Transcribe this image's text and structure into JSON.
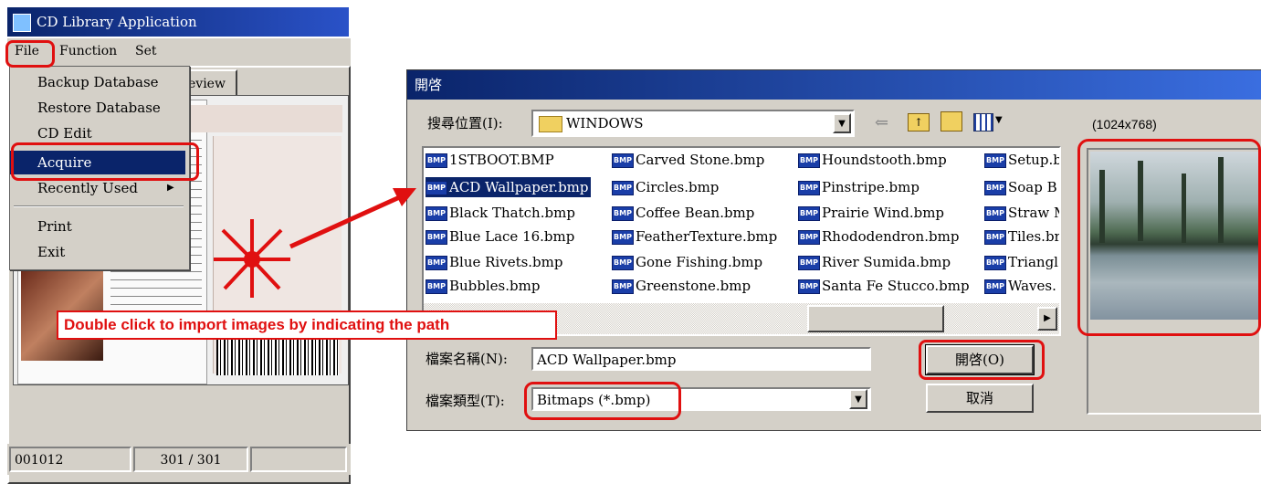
{
  "app": {
    "title": "CD Library Application",
    "menubar": [
      "File",
      "Function",
      "Set"
    ],
    "tab_preview": "eview",
    "status": {
      "id": "001012",
      "count": "301 / 301"
    }
  },
  "file_menu": {
    "items": [
      "Backup Database",
      "Restore Database",
      "CD Edit",
      "Acquire",
      "Recently Used",
      "Print",
      "Exit"
    ],
    "submenu_arrow": "▶"
  },
  "callout": {
    "text": "Double click to import images by indicating the path"
  },
  "dialog": {
    "title": "開啓",
    "look_in_label": "搜尋位置(I):",
    "look_in_value": "WINDOWS",
    "preview_size": "(1024x768)",
    "file_icon_label": "BMP",
    "files": [
      [
        "1STBOOT.BMP",
        "ACD Wallpaper.bmp",
        "Black Thatch.bmp",
        "Blue Lace 16.bmp",
        "Blue Rivets.bmp",
        "Bubbles.bmp"
      ],
      [
        "Carved Stone.bmp",
        "Circles.bmp",
        "Coffee Bean.bmp",
        "FeatherTexture.bmp",
        "Gone Fishing.bmp",
        "Greenstone.bmp"
      ],
      [
        "Houndstooth.bmp",
        "Pinstripe.bmp",
        "Prairie Wind.bmp",
        "Rhododendron.bmp",
        "River Sumida.bmp",
        "Santa Fe Stucco.bmp"
      ],
      [
        "Setup.b",
        "Soap B",
        "Straw M",
        "Tiles.br",
        "Triangl",
        "Waves."
      ]
    ],
    "filename_label": "檔案名稱(N):",
    "filename_value": "ACD Wallpaper.bmp",
    "filetype_label": "檔案類型(T):",
    "filetype_value": "Bitmaps (*.bmp)",
    "open_button": "開啓(O)",
    "cancel_button": "取消"
  },
  "colors": {
    "title_bar": "#0a246a",
    "annotation_red": "#e01010",
    "selection": "#0a246a"
  }
}
